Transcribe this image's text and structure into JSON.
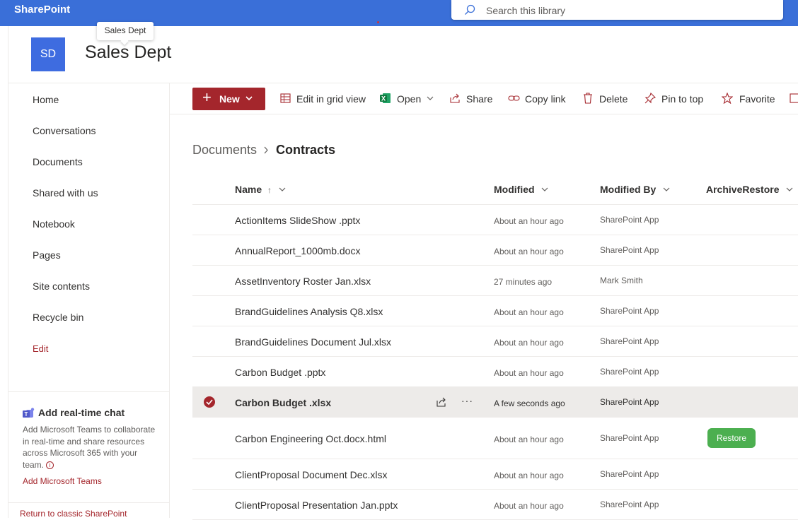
{
  "app": {
    "name": "SharePoint"
  },
  "search": {
    "placeholder": "Search this library"
  },
  "site": {
    "logo_initials": "SD",
    "title": "Sales Dept",
    "tooltip": "Sales Dept"
  },
  "nav": {
    "items": [
      {
        "label": "Home"
      },
      {
        "label": "Conversations"
      },
      {
        "label": "Documents"
      },
      {
        "label": "Shared with us"
      },
      {
        "label": "Notebook"
      },
      {
        "label": "Pages"
      },
      {
        "label": "Site contents"
      },
      {
        "label": "Recycle bin"
      },
      {
        "label": "Edit"
      }
    ],
    "chat": {
      "title": "Add real-time chat",
      "body": "Add Microsoft Teams to collaborate in real-time and share resources across Microsoft 365 with your team.",
      "link": "Add Microsoft Teams"
    },
    "classic_link": "Return to classic SharePoint"
  },
  "commands": {
    "new": "New",
    "edit_grid": "Edit in grid view",
    "open": "Open",
    "share": "Share",
    "copy_link": "Copy link",
    "delete": "Delete",
    "pin": "Pin to top",
    "favorite": "Favorite"
  },
  "breadcrumb": {
    "parent": "Documents",
    "current": "Contracts"
  },
  "columns": {
    "name": "Name",
    "modified": "Modified",
    "modified_by": "Modified By",
    "archive": "ArchiveRestore"
  },
  "rows": [
    {
      "name": "ActionItems SlideShow .pptx",
      "modified": "About an hour ago",
      "by": "SharePoint App"
    },
    {
      "name": "AnnualReport_1000mb.docx",
      "modified": "About an hour ago",
      "by": "SharePoint App"
    },
    {
      "name": "AssetInventory Roster Jan.xlsx",
      "modified": "27 minutes ago",
      "by": "Mark Smith"
    },
    {
      "name": "BrandGuidelines Analysis Q8.xlsx",
      "modified": "About an hour ago",
      "by": "SharePoint App"
    },
    {
      "name": "BrandGuidelines Document Jul.xlsx",
      "modified": "About an hour ago",
      "by": "SharePoint App"
    },
    {
      "name": "Carbon Budget .pptx",
      "modified": "About an hour ago",
      "by": "SharePoint App"
    },
    {
      "name": "Carbon Budget .xlsx",
      "modified": "A few seconds ago",
      "by": "SharePoint App",
      "selected": true
    },
    {
      "name": "Carbon Engineering Oct.docx.html",
      "modified": "About an hour ago",
      "by": "SharePoint App",
      "archive_action": "Restore"
    },
    {
      "name": "ClientProposal Document Dec.xlsx",
      "modified": "About an hour ago",
      "by": "SharePoint App"
    },
    {
      "name": "ClientProposal Presentation Jan.pptx",
      "modified": "About an hour ago",
      "by": "SharePoint App"
    }
  ],
  "colors": {
    "brand_bar": "#3a6fd8",
    "accent": "#a4262c",
    "restore": "#4caf50"
  }
}
